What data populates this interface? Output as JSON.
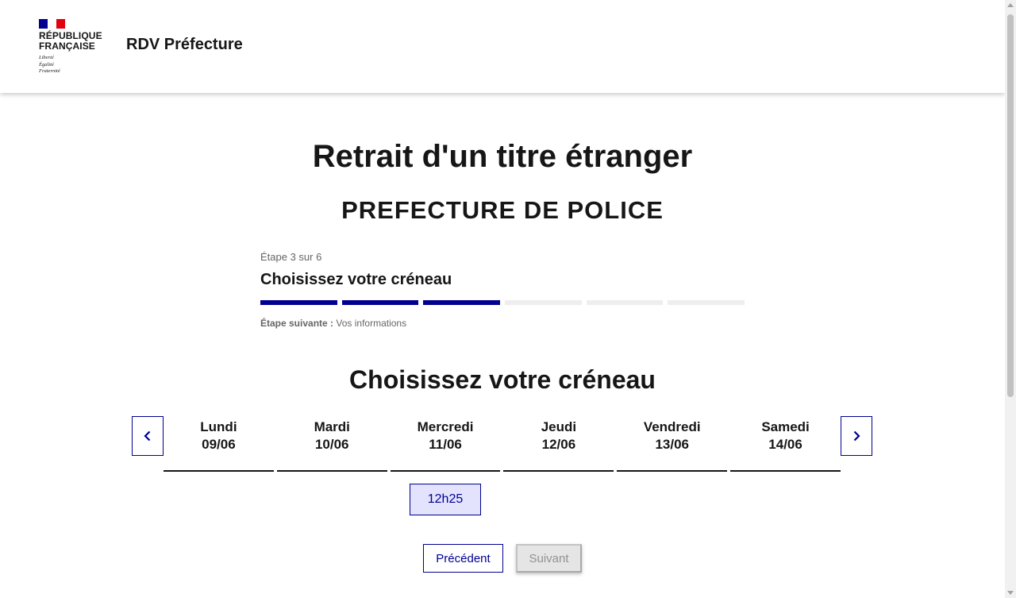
{
  "header": {
    "logo_text": "RÉPUBLIQUE FRANÇAISE",
    "motto": [
      "Liberté",
      "Égalité",
      "Fraternité"
    ],
    "service_title": "RDV Préfecture"
  },
  "page": {
    "title": "Retrait d'un titre étranger",
    "subtitle": "PREFECTURE DE POLICE"
  },
  "stepper": {
    "state": "Étape 3 sur 6",
    "title": "Choisissez votre créneau",
    "current_step": 3,
    "total_steps": 6,
    "next_label": "Étape suivante :",
    "next_value": "Vos informations"
  },
  "calendar": {
    "section_title": "Choisissez votre créneau",
    "days": [
      {
        "name": "Lundi",
        "date": "09/06"
      },
      {
        "name": "Mardi",
        "date": "10/06"
      },
      {
        "name": "Mercredi",
        "date": "11/06"
      },
      {
        "name": "Jeudi",
        "date": "12/06"
      },
      {
        "name": "Vendredi",
        "date": "13/06"
      },
      {
        "name": "Samedi",
        "date": "14/06"
      }
    ],
    "slot": "12h25"
  },
  "actions": {
    "previous": "Précédent",
    "next": "Suivant"
  },
  "colors": {
    "primary": "#000091",
    "slot_bg": "#e3e3fd",
    "disabled_bg": "#e5e5e5"
  }
}
